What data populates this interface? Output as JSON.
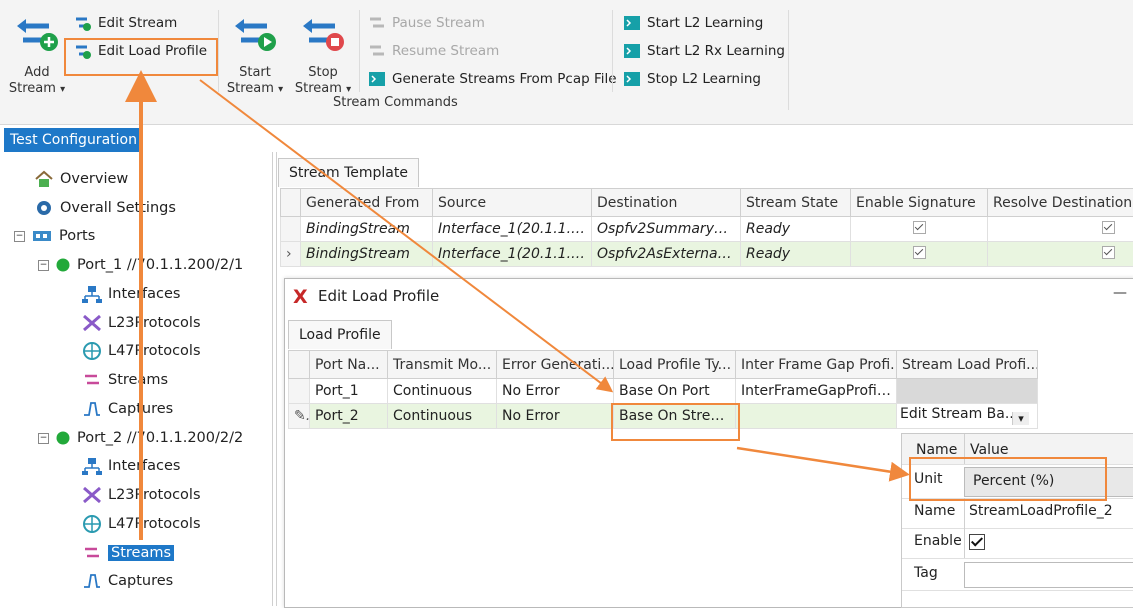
{
  "ribbon": {
    "add_stream": [
      "Add",
      "Stream"
    ],
    "edit_stream": "Edit Stream",
    "edit_load_profile": "Edit Load Profile",
    "start_stream": [
      "Start",
      "Stream"
    ],
    "stop_stream": [
      "Stop",
      "Stream"
    ],
    "pause_stream": "Pause Stream",
    "resume_stream": "Resume Stream",
    "generate_from_pcap": "Generate Streams From Pcap File",
    "group_label": "Stream Commands",
    "start_l2_learning": "Start L2 Learning",
    "start_l2_rx_learning": "Start L2 Rx Learning",
    "stop_l2_learning": "Stop L2 Learning",
    "dropdown_glyph": "▾"
  },
  "left_panel": {
    "title": "Test Configuration",
    "overview": "Overview",
    "overall_settings": "Overall Settings",
    "ports": "Ports",
    "port1": {
      "label": "Port_1 //70.1.1.200/2/1",
      "interfaces": "Interfaces",
      "l23": "L23Protocols",
      "l47": "L47Protocols",
      "streams": "Streams",
      "captures": "Captures"
    },
    "port2": {
      "label": "Port_2 //70.1.1.200/2/2",
      "interfaces": "Interfaces",
      "l23": "L23Protocols",
      "l47": "L47Protocols",
      "streams": "Streams",
      "captures": "Captures"
    },
    "expander_minus": "−"
  },
  "stream_template": {
    "tab": "Stream Template",
    "columns": [
      "Generated From",
      "Source",
      "Destination",
      "Stream State",
      "Enable Signature",
      "Resolve Destination M"
    ],
    "rows": [
      {
        "generated_from": "BindingStream",
        "source": "Interface_1(20.1.1.2/24)",
        "destination": "Ospfv2SummaryRo...",
        "state": "Ready"
      },
      {
        "generated_from": "BindingStream",
        "source": "Interface_1(20.1.1.2/24)",
        "destination": "Ospfv2AsExternalR...",
        "state": "Ready"
      }
    ],
    "row_indicator": "›"
  },
  "dialog": {
    "title": "Edit Load Profile",
    "close_glyph": "—",
    "x_logo": "X",
    "tab": "Load Profile",
    "columns": [
      "Port Na...",
      "Transmit Mo...",
      "Error Generati...",
      "Load Profile Ty...",
      "Inter Frame Gap Profi...",
      "Stream Load Profi..."
    ],
    "rows": [
      {
        "port": "Port_1",
        "mode": "Continuous",
        "error": "No Error",
        "type": "Base On Port",
        "ifg": "InterFrameGapProfile...",
        "slp": ""
      },
      {
        "port": "Port_2",
        "mode": "Continuous",
        "error": "No Error",
        "type": "Base On Stream",
        "ifg": "",
        "slp": "Edit Stream Ba..."
      }
    ],
    "edit_glyph": "✎",
    "combo_arrow": "▾"
  },
  "properties": {
    "col_name": "Name",
    "col_value": "Value",
    "unit_label": "Unit",
    "unit_value": "Percent (%)",
    "name_label": "Name",
    "name_value": "StreamLoadProfile_2",
    "enable_label": "Enable",
    "tag_label": "Tag"
  },
  "colors": {
    "accent": "#1e78c8",
    "highlight": "#f0883c",
    "selected_row": "#e9f5e0"
  }
}
